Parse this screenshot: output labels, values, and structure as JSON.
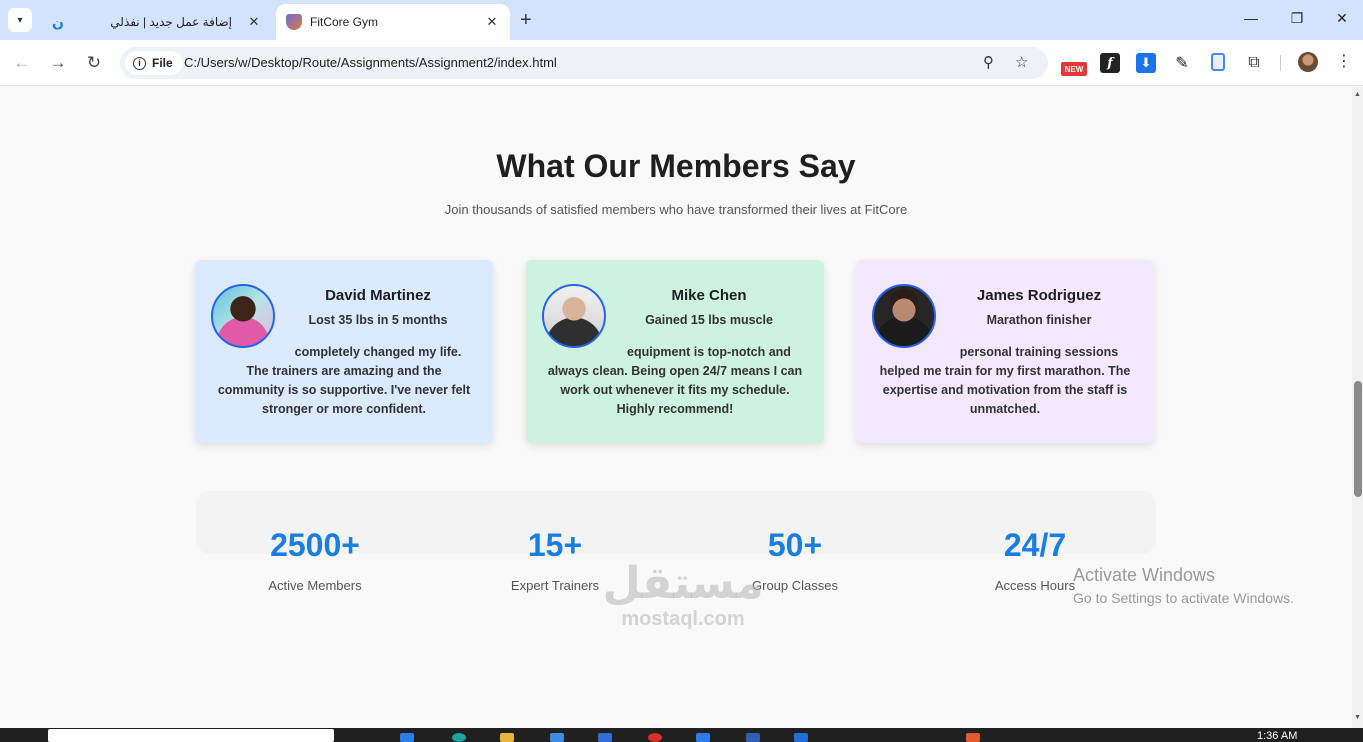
{
  "browser": {
    "tabs": [
      {
        "title": "إضافة عمل جديد | نفذلي",
        "active": false,
        "favicon": "mostaql-icon"
      },
      {
        "title": "FitCore Gym",
        "active": true,
        "favicon": "fitcore-shield-icon"
      }
    ],
    "new_tab": "+",
    "file_chip": "File",
    "url": "C:/Users/w/Desktop/Route/Assignments/Assignment2/index.html",
    "extension_badge": "NEW"
  },
  "section": {
    "title": "What Our Members Say",
    "subtitle": "Join thousands of satisfied members who have transformed their lives at FitCore"
  },
  "testimonials": [
    {
      "name": "David Martinez",
      "achievement": "Lost 35 lbs in 5 months",
      "quote_first": "completely changed my life.",
      "quote_rest": "The trainers are amazing and the community is so supportive. I've never felt stronger or more confident.",
      "color": "#dbeafe"
    },
    {
      "name": "Mike Chen",
      "achievement": "Gained 15 lbs muscle",
      "quote_first": "equipment is top-notch and",
      "quote_rest": "always clean. Being open 24/7 means I can work out whenever it fits my schedule. Highly recommend!",
      "color": "#cdf3e0"
    },
    {
      "name": "James Rodriguez",
      "achievement": "Marathon finisher",
      "quote_first": "personal training sessions",
      "quote_rest": "helped me train for my first marathon. The expertise and motivation from the staff is unmatched.",
      "color": "#f3e8ff"
    }
  ],
  "stats": [
    {
      "value": "2500+",
      "label": "Active Members"
    },
    {
      "value": "15+",
      "label": "Expert Trainers"
    },
    {
      "value": "50+",
      "label": "Group Classes"
    },
    {
      "value": "24/7",
      "label": "Access Hours"
    }
  ],
  "windows_notice": {
    "title": "Activate Windows",
    "text": "Go to Settings to activate Windows."
  },
  "watermark": {
    "arabic": "مستقل",
    "latin": "mostaql.com"
  },
  "taskbar": {
    "time": "1:36 AM"
  },
  "colors": {
    "accent": "#1a7de0",
    "avatar_border": "#2563eb"
  }
}
